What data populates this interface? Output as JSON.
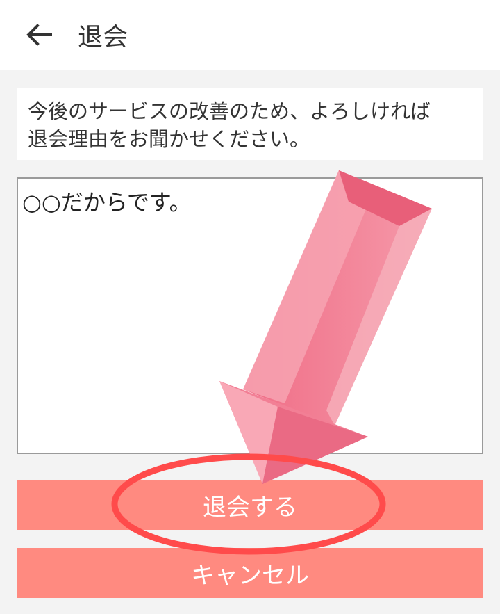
{
  "header": {
    "back_icon": "arrow-left-icon",
    "title": "退会"
  },
  "notice": {
    "text": "今後のサービスの改善のため、よろしければ\n退会理由をお聞かせください。"
  },
  "reason_input": {
    "value": "○○だからです。"
  },
  "actions": {
    "withdraw_label": "退会する",
    "cancel_label": "キャンセル"
  },
  "annotation": {
    "arrow_icon": "pointing-arrow-icon",
    "circle_icon": "highlight-circle-icon",
    "arrow_color": "#f47f94",
    "circle_color": "#ff4b4b"
  },
  "colors": {
    "accent": "#ff8a80",
    "background": "#f3f3f3"
  }
}
